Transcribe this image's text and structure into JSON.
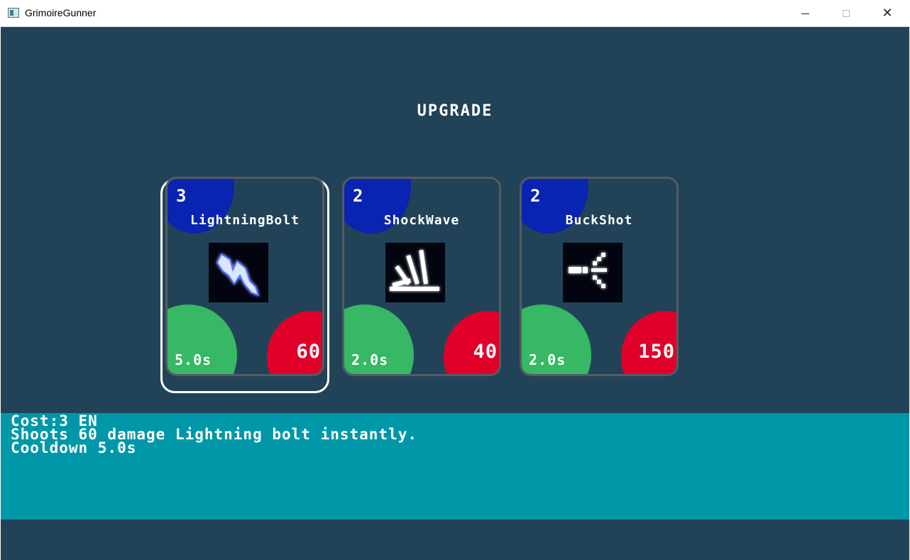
{
  "window": {
    "title": "GrimoireGunner",
    "controls": {
      "minimize": "minimize",
      "maximize": "maximize",
      "close": "✕"
    }
  },
  "screen": {
    "heading": "UPGRADE",
    "cards": [
      {
        "cost": "3",
        "name": "LightningBolt",
        "icon": "lightning-icon",
        "cooldown": "5.0s",
        "damage": "60",
        "selected": true
      },
      {
        "cost": "2",
        "name": "ShockWave",
        "icon": "shockwave-icon",
        "cooldown": "2.0s",
        "damage": "40",
        "selected": false
      },
      {
        "cost": "2",
        "name": "BuckShot",
        "icon": "buckshot-icon",
        "cooldown": "2.0s",
        "damage": "150",
        "selected": false
      }
    ],
    "description": {
      "line1": "Cost:3 EN",
      "line2": "Shoots 60 damage Lightning bolt instantly.",
      "line3": "Cooldown 5.0s"
    }
  },
  "colors": {
    "background": "#224357",
    "cost_circle": "#0824b0",
    "cooldown_circle": "#36b864",
    "damage_circle": "#e1002a",
    "info_panel": "#0098a8",
    "selection_frame": "#ffffff"
  }
}
